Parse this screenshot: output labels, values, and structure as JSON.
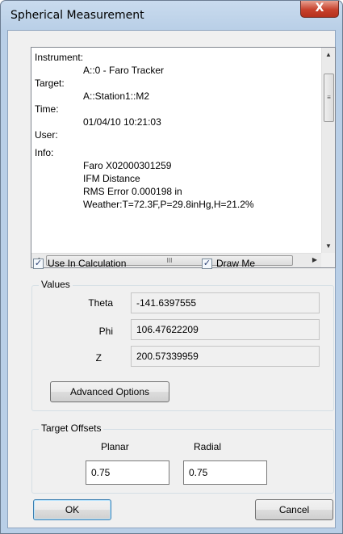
{
  "window": {
    "title": "Spherical Measurement",
    "close_glyph": "X"
  },
  "info": {
    "lines": [
      {
        "text": "Instrument:",
        "indent": false
      },
      {
        "text": "A::0 - Faro Tracker",
        "indent": true
      },
      {
        "text": "Target:",
        "indent": false
      },
      {
        "text": "A::Station1::M2",
        "indent": true
      },
      {
        "text": "Time:",
        "indent": false
      },
      {
        "text": "01/04/10 10:21:03",
        "indent": true
      },
      {
        "text": "User:",
        "indent": false
      },
      {
        "text": "",
        "indent": false
      },
      {
        "text": "Info:",
        "indent": false
      },
      {
        "text": "Faro X02000301259",
        "indent": true
      },
      {
        "text": "IFM Distance",
        "indent": true
      },
      {
        "text": "RMS Error 0.000198 in",
        "indent": true
      },
      {
        "text": "Weather:T=72.3F,P=29.8inHg,H=21.2%",
        "indent": true
      }
    ]
  },
  "options": {
    "use_in_calculation": {
      "label": "Use In Calculation",
      "checked": true
    },
    "draw_me": {
      "label": "Draw Me",
      "checked": true
    }
  },
  "values": {
    "title": "Values",
    "theta": {
      "label": "Theta",
      "value": "-141.6397555"
    },
    "phi": {
      "label": "Phi",
      "value": "106.47622209"
    },
    "z": {
      "label": "Z",
      "value": "200.57339959"
    },
    "advanced_label": "Advanced Options"
  },
  "offsets": {
    "title": "Target Offsets",
    "planar": {
      "label": "Planar",
      "value": "0.75"
    },
    "radial": {
      "label": "Radial",
      "value": "0.75"
    }
  },
  "buttons": {
    "ok": "OK",
    "cancel": "Cancel"
  },
  "icons": {
    "check": "✓",
    "arrow_up": "▲",
    "arrow_down": "▼",
    "arrow_left": "◀",
    "arrow_right": "▶",
    "grip_v": "≡",
    "grip_h": "III"
  }
}
